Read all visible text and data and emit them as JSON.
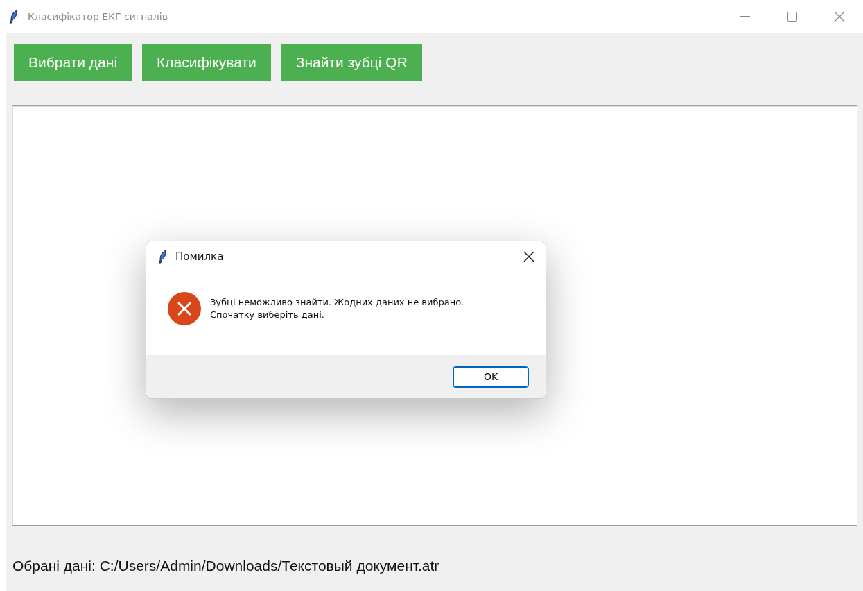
{
  "window": {
    "title": "Класифікатор ЕКГ сигналів"
  },
  "buttons": [
    "Вибрати дані",
    "Класифікувати",
    "Знайти зубці QR"
  ],
  "status_label": "Обрані дані: C:/Users/Admin/Downloads/Текстовый документ.atr",
  "dialog": {
    "title": "Помилка",
    "kind": "error",
    "message": "Зубці неможливо знайти. Жодних даних не вибрано.\nСпочатку виберіть дані.",
    "button": "OK"
  }
}
